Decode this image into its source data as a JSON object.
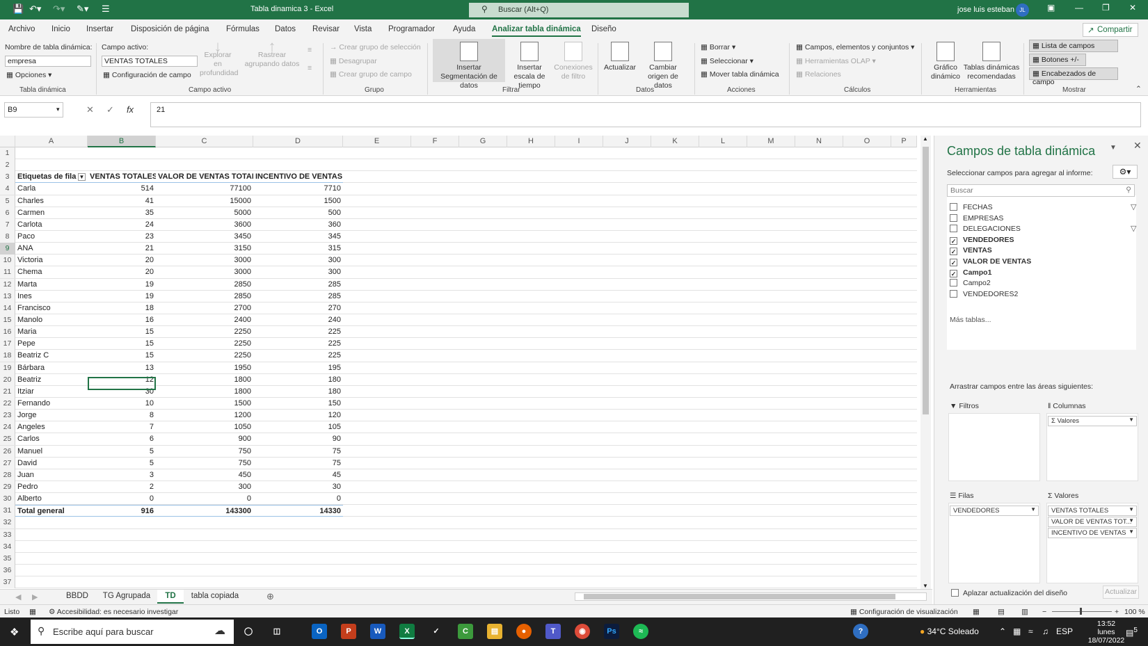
{
  "title": "Tabla dinamica 3  -  Excel",
  "search_placeholder": "Buscar (Alt+Q)",
  "user": {
    "name": "jose luis esteban",
    "initials": "JL"
  },
  "menu": [
    "Archivo",
    "Inicio",
    "Insertar",
    "Disposición de página",
    "Fórmulas",
    "Datos",
    "Revisar",
    "Vista",
    "Programador",
    "Ayuda",
    "Analizar tabla dinámica",
    "Diseño"
  ],
  "share_label": "Compartir",
  "ribbon": {
    "pt_name_label": "Nombre de tabla dinámica:",
    "pt_name_value": "empresa",
    "options": "Opciones",
    "active_field_label": "Campo activo:",
    "active_field_value": "VENTAS TOTALES",
    "field_config": "Configuración de campo",
    "drill_down": "Explorar en profundidad",
    "drill_up": "Rastrear agrupando datos",
    "group_selection": "Crear grupo de selección",
    "ungroup": "Desagrupar",
    "group_field": "Crear grupo de campo",
    "insert_slicer": "Insertar Segmentación de datos",
    "insert_timeline": "Insertar escala de tiempo",
    "filter_connections": "Conexiones de filtro",
    "refresh": "Actualizar",
    "change_source": "Cambiar origen de datos",
    "clear": "Borrar",
    "select": "Seleccionar",
    "move_pt": "Mover tabla dinámica",
    "fields_items_sets": "Campos, elementos y conjuntos",
    "olap_tools": "Herramientas OLAP",
    "relationships": "Relaciones",
    "pivot_chart": "Gráfico dinámico",
    "recommended_pt": "Tablas dinámicas recomendadas",
    "field_list": "Lista de campos",
    "buttons": "Botones +/-",
    "field_headers": "Encabezados de campo",
    "groups": [
      "Tabla dinámica",
      "Campo activo",
      "Grupo",
      "Filtrar",
      "Datos",
      "Acciones",
      "Cálculos",
      "Herramientas",
      "Mostrar"
    ]
  },
  "formula": {
    "cell_ref": "B9",
    "value": "21"
  },
  "columns": [
    "A",
    "B",
    "C",
    "D",
    "E",
    "F",
    "G",
    "H",
    "I",
    "J",
    "K",
    "L",
    "M",
    "N",
    "O",
    "P"
  ],
  "table": {
    "headers": [
      "Etiquetas de fila",
      "VENTAS TOTALES",
      "VALOR DE VENTAS TOTAL",
      "INCENTIVO DE VENTAS"
    ],
    "rows": [
      [
        "Carla",
        "514",
        "77100",
        "7710"
      ],
      [
        "Charles",
        "41",
        "15000",
        "1500"
      ],
      [
        "Carmen",
        "35",
        "5000",
        "500"
      ],
      [
        "Carlota",
        "24",
        "3600",
        "360"
      ],
      [
        "Paco",
        "23",
        "3450",
        "345"
      ],
      [
        "ANA",
        "21",
        "3150",
        "315"
      ],
      [
        "Victoria",
        "20",
        "3000",
        "300"
      ],
      [
        "Chema",
        "20",
        "3000",
        "300"
      ],
      [
        "Marta",
        "19",
        "2850",
        "285"
      ],
      [
        "Ines",
        "19",
        "2850",
        "285"
      ],
      [
        "Francisco",
        "18",
        "2700",
        "270"
      ],
      [
        "Manolo",
        "16",
        "2400",
        "240"
      ],
      [
        "Maria",
        "15",
        "2250",
        "225"
      ],
      [
        "Pepe",
        "15",
        "2250",
        "225"
      ],
      [
        "Beatriz C",
        "15",
        "2250",
        "225"
      ],
      [
        "Bárbara",
        "13",
        "1950",
        "195"
      ],
      [
        "Beatriz",
        "12",
        "1800",
        "180"
      ],
      [
        "Itziar",
        "30",
        "1800",
        "180"
      ],
      [
        "Fernando",
        "10",
        "1500",
        "150"
      ],
      [
        "Jorge",
        "8",
        "1200",
        "120"
      ],
      [
        "Angeles",
        "7",
        "1050",
        "105"
      ],
      [
        "Carlos",
        "6",
        "900",
        "90"
      ],
      [
        "Manuel",
        "5",
        "750",
        "75"
      ],
      [
        "David",
        "5",
        "750",
        "75"
      ],
      [
        "Juan",
        "3",
        "450",
        "45"
      ],
      [
        "Pedro",
        "2",
        "300",
        "30"
      ],
      [
        "Alberto",
        "0",
        "0",
        "0"
      ]
    ],
    "total": [
      "Total general",
      "916",
      "143300",
      "14330"
    ]
  },
  "sheets": [
    "BBDD",
    "TG Agrupada",
    "TD",
    "tabla copiada"
  ],
  "active_sheet": "TD",
  "status": {
    "ready": "Listo",
    "accessibility": "Accesibilidad: es necesario investigar",
    "display_settings": "Configuración de visualización",
    "zoom": "100 %"
  },
  "panel": {
    "title": "Campos de tabla dinámica",
    "subtitle": "Seleccionar campos para agregar al informe:",
    "search_placeholder": "Buscar",
    "fields": [
      {
        "name": "FECHAS",
        "checked": false,
        "filter": true
      },
      {
        "name": "EMPRESAS",
        "checked": false,
        "filter": false
      },
      {
        "name": "DELEGACIONES",
        "checked": false,
        "filter": true
      },
      {
        "name": "VENDEDORES",
        "checked": true,
        "filter": false
      },
      {
        "name": "VENTAS",
        "checked": true,
        "filter": false
      },
      {
        "name": "VALOR DE VENTAS",
        "checked": true,
        "filter": false
      },
      {
        "name": "Campo1",
        "checked": true,
        "filter": false
      },
      {
        "name": "Campo2",
        "checked": false,
        "filter": false
      },
      {
        "name": "VENDEDORES2",
        "checked": false,
        "filter": false
      }
    ],
    "more_tables": "Más tablas...",
    "drag_label": "Arrastrar campos entre las áreas siguientes:",
    "filters_label": "Filtros",
    "columns_label": "Columnas",
    "rows_label": "Filas",
    "values_label": "Valores",
    "columns_items": [
      "Valores"
    ],
    "rows_items": [
      "VENDEDORES"
    ],
    "values_items": [
      "VENTAS TOTALES",
      "VALOR DE VENTAS TOT...",
      "INCENTIVO DE VENTAS"
    ],
    "defer_update": "Aplazar actualización del diseño",
    "update_button": "Actualizar"
  },
  "taskbar": {
    "search_placeholder": "Escribe aquí para buscar",
    "weather": "34°C  Soleado",
    "lang": "ESP",
    "time": "13:52",
    "day": "lunes",
    "date": "18/07/2022",
    "notif_count": "5"
  },
  "colors": {
    "accent": "#217346"
  }
}
